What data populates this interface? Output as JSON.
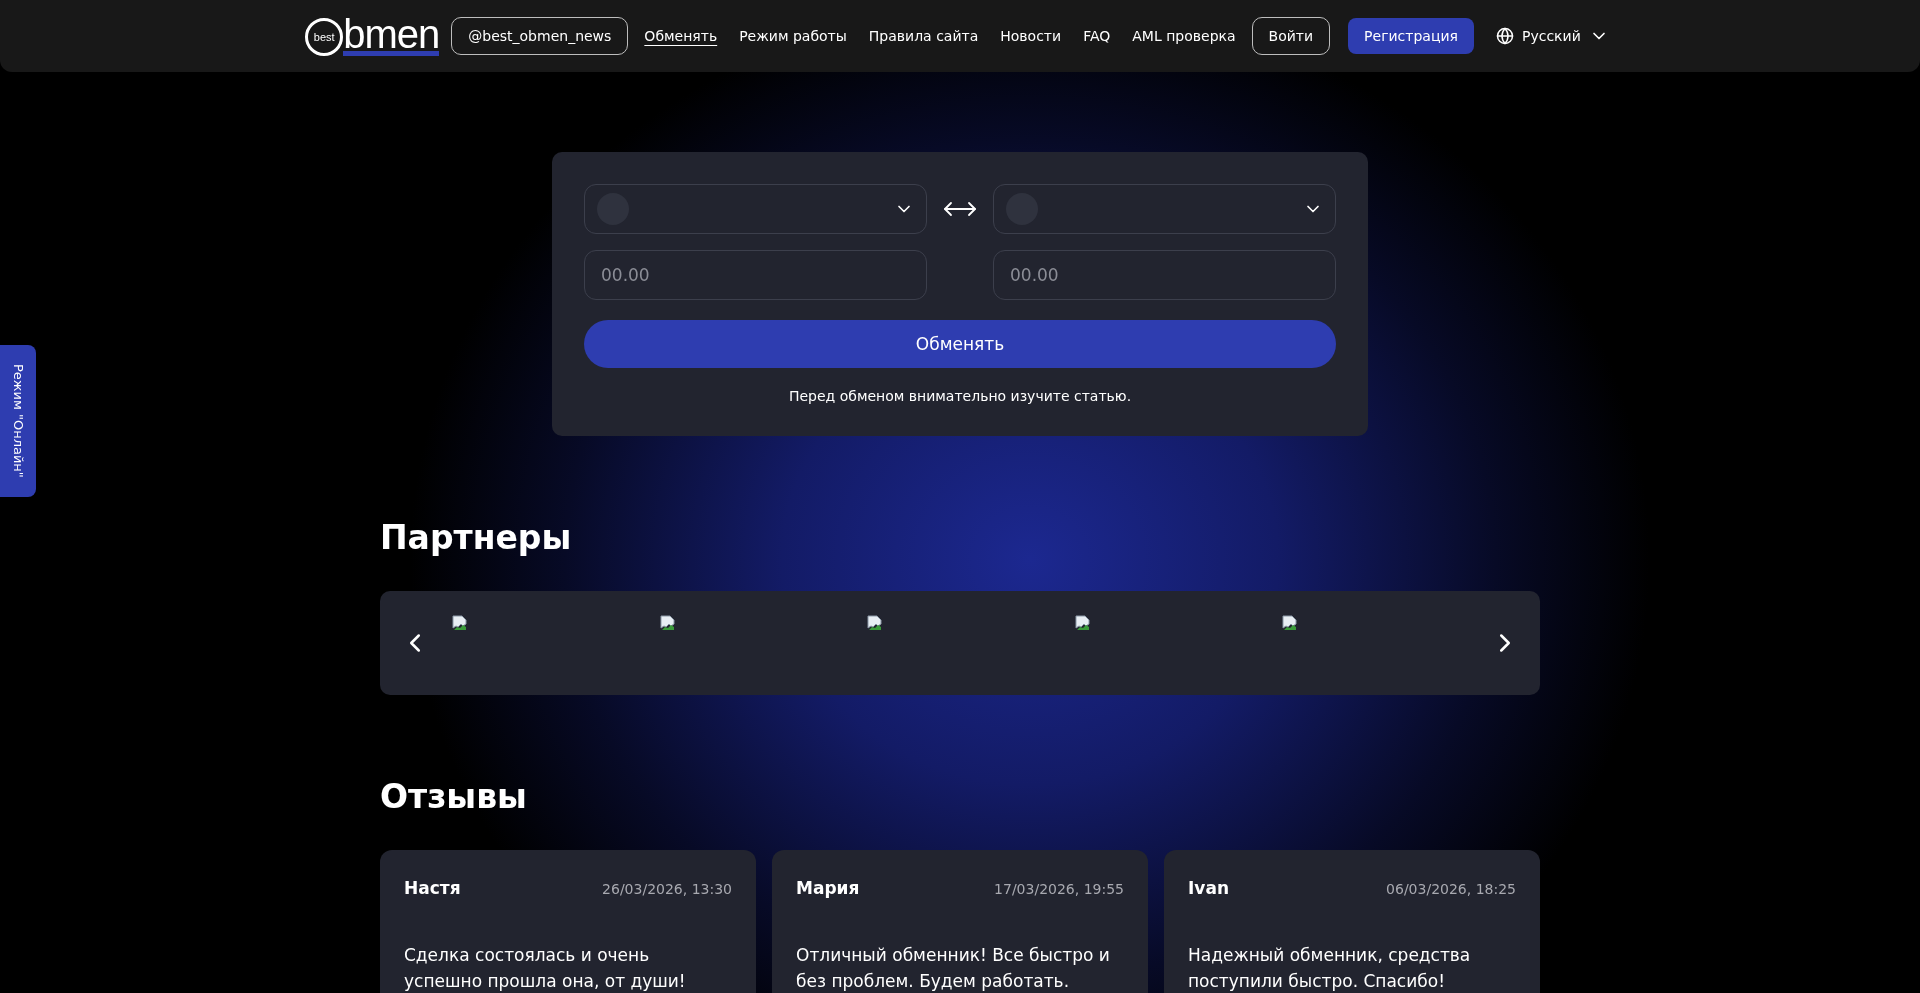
{
  "header": {
    "logo": {
      "badge": "best",
      "text": "bmen"
    },
    "telegram": "@best_obmen_news",
    "nav": [
      {
        "label": "Обменять",
        "selected": true
      },
      {
        "label": "Режим работы",
        "selected": false
      },
      {
        "label": "Правила сайта",
        "selected": false
      },
      {
        "label": "Новости",
        "selected": false
      },
      {
        "label": "FAQ",
        "selected": false
      },
      {
        "label": "AML проверка",
        "selected": false
      }
    ],
    "login": "Войти",
    "register": "Регистрация",
    "language": "Русский"
  },
  "side_tab": "Режим \"Онлайн\"",
  "exchange": {
    "amounts": [
      {
        "placeholder": "00.00"
      },
      {
        "placeholder": "00.00"
      }
    ],
    "button": "Обменять",
    "note": {
      "before": "Перед обменом внимательно изучите ",
      "link": "статью",
      "after": "."
    }
  },
  "partners": {
    "title": "Партнеры",
    "logos": [
      {
        "kind": "broken-image"
      },
      {
        "kind": "broken-image"
      },
      {
        "kind": "broken-image"
      },
      {
        "kind": "broken-image"
      },
      {
        "kind": "broken-image"
      }
    ]
  },
  "reviews": {
    "title": "Отзывы",
    "items": [
      {
        "name": "Настя",
        "date": "26/03/2026, 13:30",
        "text": "Сделка состоялась и очень успешно прошла она, от души!"
      },
      {
        "name": "Мария",
        "date": "17/03/2026, 19:55",
        "text": "Отличный обменник! Все быстро и без проблем. Будем работать."
      },
      {
        "name": "Ivan",
        "date": "06/03/2026, 18:25",
        "text": "Надежный обменник, средства поступили быстро. Спасибо!"
      }
    ]
  }
}
